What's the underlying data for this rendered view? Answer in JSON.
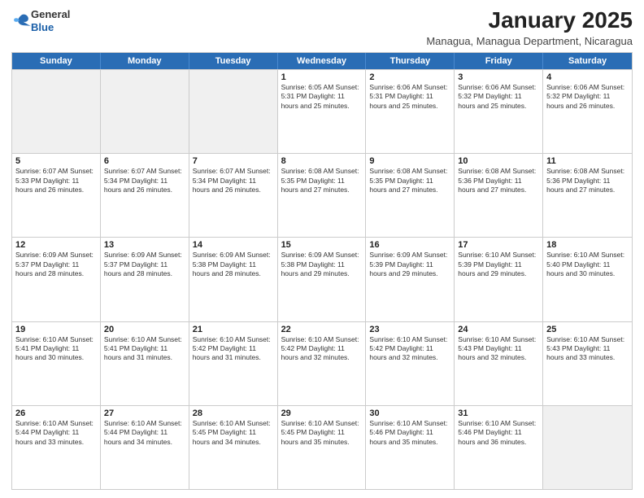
{
  "logo": {
    "general": "General",
    "blue": "Blue"
  },
  "title": "January 2025",
  "subtitle": "Managua, Managua Department, Nicaragua",
  "days": [
    "Sunday",
    "Monday",
    "Tuesday",
    "Wednesday",
    "Thursday",
    "Friday",
    "Saturday"
  ],
  "weeks": [
    [
      {
        "day": "",
        "info": ""
      },
      {
        "day": "",
        "info": ""
      },
      {
        "day": "",
        "info": ""
      },
      {
        "day": "1",
        "info": "Sunrise: 6:05 AM\nSunset: 5:31 PM\nDaylight: 11 hours\nand 25 minutes."
      },
      {
        "day": "2",
        "info": "Sunrise: 6:06 AM\nSunset: 5:31 PM\nDaylight: 11 hours\nand 25 minutes."
      },
      {
        "day": "3",
        "info": "Sunrise: 6:06 AM\nSunset: 5:32 PM\nDaylight: 11 hours\nand 25 minutes."
      },
      {
        "day": "4",
        "info": "Sunrise: 6:06 AM\nSunset: 5:32 PM\nDaylight: 11 hours\nand 26 minutes."
      }
    ],
    [
      {
        "day": "5",
        "info": "Sunrise: 6:07 AM\nSunset: 5:33 PM\nDaylight: 11 hours\nand 26 minutes."
      },
      {
        "day": "6",
        "info": "Sunrise: 6:07 AM\nSunset: 5:34 PM\nDaylight: 11 hours\nand 26 minutes."
      },
      {
        "day": "7",
        "info": "Sunrise: 6:07 AM\nSunset: 5:34 PM\nDaylight: 11 hours\nand 26 minutes."
      },
      {
        "day": "8",
        "info": "Sunrise: 6:08 AM\nSunset: 5:35 PM\nDaylight: 11 hours\nand 27 minutes."
      },
      {
        "day": "9",
        "info": "Sunrise: 6:08 AM\nSunset: 5:35 PM\nDaylight: 11 hours\nand 27 minutes."
      },
      {
        "day": "10",
        "info": "Sunrise: 6:08 AM\nSunset: 5:36 PM\nDaylight: 11 hours\nand 27 minutes."
      },
      {
        "day": "11",
        "info": "Sunrise: 6:08 AM\nSunset: 5:36 PM\nDaylight: 11 hours\nand 27 minutes."
      }
    ],
    [
      {
        "day": "12",
        "info": "Sunrise: 6:09 AM\nSunset: 5:37 PM\nDaylight: 11 hours\nand 28 minutes."
      },
      {
        "day": "13",
        "info": "Sunrise: 6:09 AM\nSunset: 5:37 PM\nDaylight: 11 hours\nand 28 minutes."
      },
      {
        "day": "14",
        "info": "Sunrise: 6:09 AM\nSunset: 5:38 PM\nDaylight: 11 hours\nand 28 minutes."
      },
      {
        "day": "15",
        "info": "Sunrise: 6:09 AM\nSunset: 5:38 PM\nDaylight: 11 hours\nand 29 minutes."
      },
      {
        "day": "16",
        "info": "Sunrise: 6:09 AM\nSunset: 5:39 PM\nDaylight: 11 hours\nand 29 minutes."
      },
      {
        "day": "17",
        "info": "Sunrise: 6:10 AM\nSunset: 5:39 PM\nDaylight: 11 hours\nand 29 minutes."
      },
      {
        "day": "18",
        "info": "Sunrise: 6:10 AM\nSunset: 5:40 PM\nDaylight: 11 hours\nand 30 minutes."
      }
    ],
    [
      {
        "day": "19",
        "info": "Sunrise: 6:10 AM\nSunset: 5:41 PM\nDaylight: 11 hours\nand 30 minutes."
      },
      {
        "day": "20",
        "info": "Sunrise: 6:10 AM\nSunset: 5:41 PM\nDaylight: 11 hours\nand 31 minutes."
      },
      {
        "day": "21",
        "info": "Sunrise: 6:10 AM\nSunset: 5:42 PM\nDaylight: 11 hours\nand 31 minutes."
      },
      {
        "day": "22",
        "info": "Sunrise: 6:10 AM\nSunset: 5:42 PM\nDaylight: 11 hours\nand 32 minutes."
      },
      {
        "day": "23",
        "info": "Sunrise: 6:10 AM\nSunset: 5:42 PM\nDaylight: 11 hours\nand 32 minutes."
      },
      {
        "day": "24",
        "info": "Sunrise: 6:10 AM\nSunset: 5:43 PM\nDaylight: 11 hours\nand 32 minutes."
      },
      {
        "day": "25",
        "info": "Sunrise: 6:10 AM\nSunset: 5:43 PM\nDaylight: 11 hours\nand 33 minutes."
      }
    ],
    [
      {
        "day": "26",
        "info": "Sunrise: 6:10 AM\nSunset: 5:44 PM\nDaylight: 11 hours\nand 33 minutes."
      },
      {
        "day": "27",
        "info": "Sunrise: 6:10 AM\nSunset: 5:44 PM\nDaylight: 11 hours\nand 34 minutes."
      },
      {
        "day": "28",
        "info": "Sunrise: 6:10 AM\nSunset: 5:45 PM\nDaylight: 11 hours\nand 34 minutes."
      },
      {
        "day": "29",
        "info": "Sunrise: 6:10 AM\nSunset: 5:45 PM\nDaylight: 11 hours\nand 35 minutes."
      },
      {
        "day": "30",
        "info": "Sunrise: 6:10 AM\nSunset: 5:46 PM\nDaylight: 11 hours\nand 35 minutes."
      },
      {
        "day": "31",
        "info": "Sunrise: 6:10 AM\nSunset: 5:46 PM\nDaylight: 11 hours\nand 36 minutes."
      },
      {
        "day": "",
        "info": ""
      }
    ]
  ]
}
